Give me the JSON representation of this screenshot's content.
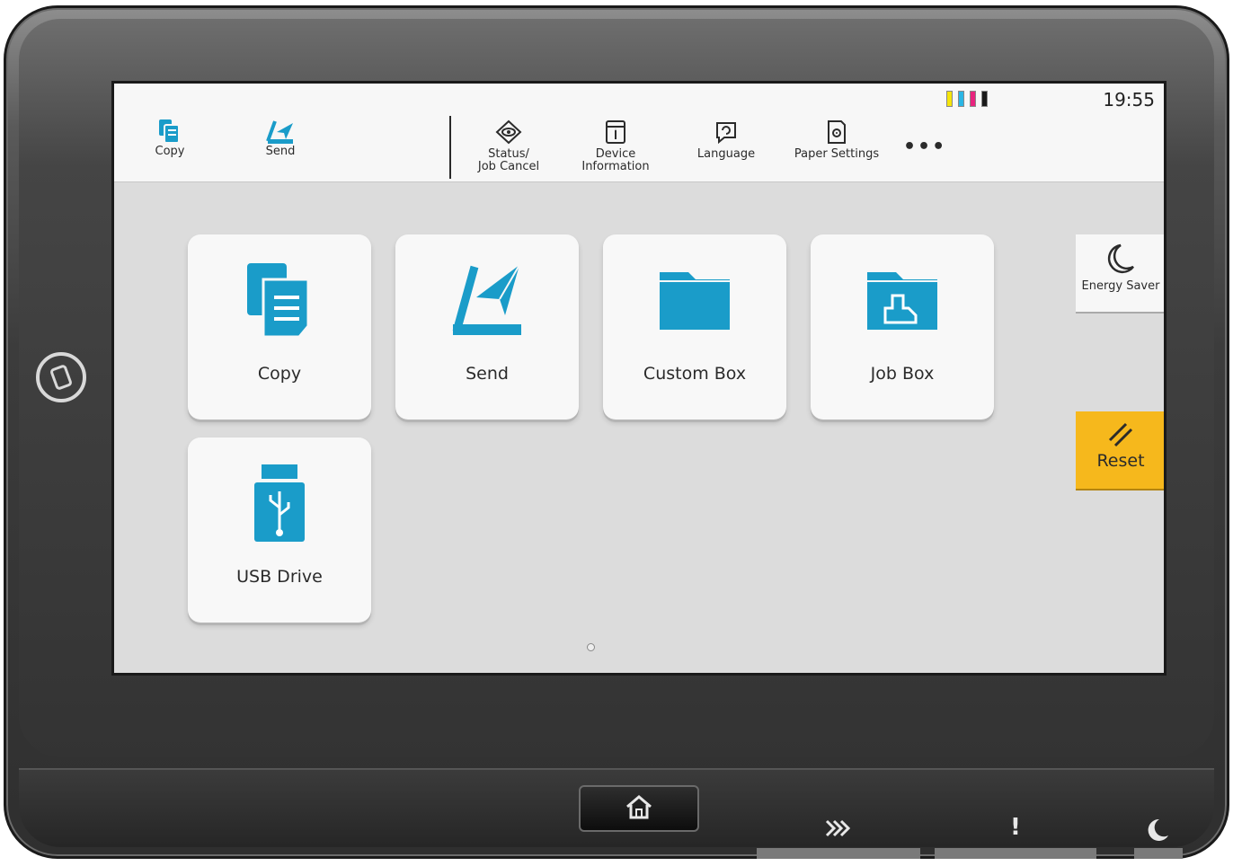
{
  "status_bar": {
    "time": "19:55",
    "toner_colors": [
      "#f5e50a",
      "#2ab6e5",
      "#e8247e",
      "#1a1a1a"
    ]
  },
  "quick_access": [
    {
      "label": "Copy",
      "icon": "copy-icon"
    },
    {
      "label": "Send",
      "icon": "send-icon"
    }
  ],
  "menu": [
    {
      "label_line1": "Status/",
      "label_line2": "Job Cancel",
      "icon": "eye-icon"
    },
    {
      "label_line1": "Device",
      "label_line2": "Information",
      "icon": "info-icon"
    },
    {
      "label_line1": "Language",
      "label_line2": "",
      "icon": "language-icon"
    },
    {
      "label_line1": "Paper Settings",
      "label_line2": "",
      "icon": "paper-settings-icon"
    }
  ],
  "more_label": "•••",
  "apps": [
    {
      "label": "Copy",
      "icon": "copy-icon"
    },
    {
      "label": "Send",
      "icon": "send-icon"
    },
    {
      "label": "Custom Box",
      "icon": "folder-icon"
    },
    {
      "label": "Job Box",
      "icon": "job-box-icon"
    },
    {
      "label": "USB Drive",
      "icon": "usb-icon"
    }
  ],
  "side": {
    "energy_saver": "Energy Saver",
    "reset": "Reset"
  },
  "hardware": {
    "home_icon": "home-icon",
    "processing_icon": "processing-icon",
    "attention_symbol": "!",
    "sleep_icon": "moon-icon"
  },
  "colors": {
    "accent": "#1a9cc9",
    "reset": "#f6b81c"
  }
}
